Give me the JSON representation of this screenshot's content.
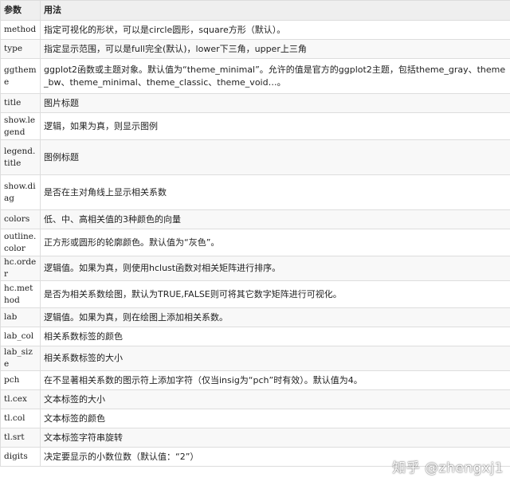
{
  "table": {
    "headers": [
      "参数",
      "用法"
    ],
    "rows": [
      [
        "method",
        "指定可视化的形状，可以是circle圆形，square方形（默认）。"
      ],
      [
        "type",
        "指定显示范围，可以是full完全(默认)，lower下三角，upper上三角"
      ],
      [
        "ggtheme",
        "ggplot2函数或主题对象。默认值为“theme_minimal”。允许的值是官方的ggplot2主题，包括theme_gray、theme_bw、theme_minimal、theme_classic、theme_void…。"
      ],
      [
        "title",
        "图片标题"
      ],
      [
        "show.legend",
        "逻辑，如果为真，则显示图例"
      ],
      [
        "legend.title",
        "图例标题"
      ],
      [
        "show.diag",
        "是否在主对角线上显示相关系数"
      ],
      [
        "colors",
        "低、中、高相关值的3种颜色的向量"
      ],
      [
        "outline.color",
        "正方形或圆形的轮廓颜色。默认值为“灰色”。"
      ],
      [
        "hc.order",
        "逻辑值。如果为真，则使用hclust函数对相关矩阵进行排序。"
      ],
      [
        "hc.method",
        "是否为相关系数绘图，默认为TRUE,FALSE则可将其它数字矩阵进行可视化。"
      ],
      [
        "lab",
        "逻辑值。如果为真，则在绘图上添加相关系数。"
      ],
      [
        "lab_col",
        "相关系数标签的颜色"
      ],
      [
        "lab_size",
        "相关系数标签的大小"
      ],
      [
        "pch",
        "在不显著相关系数的图示符上添加字符（仅当insig为“pch”时有效）。默认值为4。"
      ],
      [
        "tl.cex",
        "文本标签的大小"
      ],
      [
        "tl.col",
        "文本标签的颜色"
      ],
      [
        "tl.srt",
        "文本标签字符串旋转"
      ],
      [
        "digits",
        "决定要显示的小数位数（默认值：“2”）"
      ]
    ]
  },
  "watermark": "知乎 @zhengxj1"
}
